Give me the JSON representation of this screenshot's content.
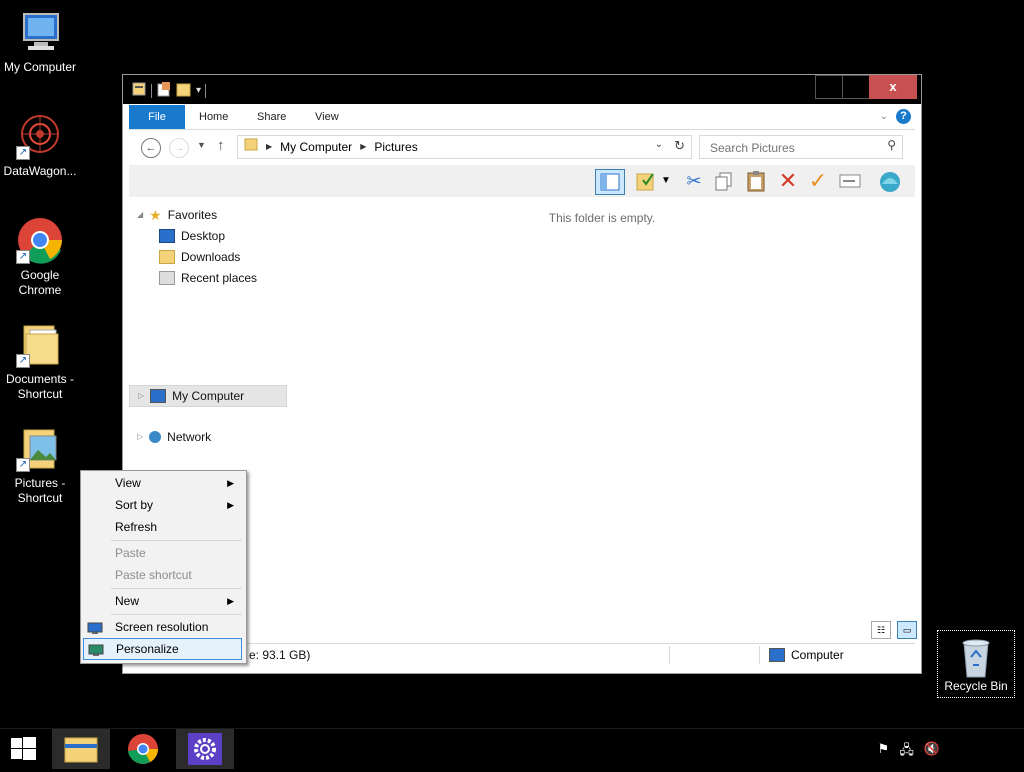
{
  "desktop": {
    "icons": [
      {
        "label": "My Computer"
      },
      {
        "label": "DataWagon..."
      },
      {
        "label": "Google Chrome"
      },
      {
        "label": "Documents - Shortcut"
      },
      {
        "label": "Pictures - Shortcut"
      }
    ],
    "recycle_bin": {
      "label": "Recycle Bin"
    }
  },
  "window": {
    "ribbon_tabs": [
      "File",
      "Home",
      "Share",
      "View"
    ],
    "help_label": "?",
    "address": {
      "crumbs": [
        "My Computer",
        "Pictures"
      ]
    },
    "search": {
      "placeholder": "Search Pictures"
    },
    "navigation": {
      "favorites_label": "Favorites",
      "favorites_items": [
        "Desktop",
        "Downloads",
        "Recent places"
      ],
      "computer_label": "My Computer",
      "network_label": "Network"
    },
    "content": {
      "empty_message": "This folder is empty."
    },
    "status": {
      "free_space": "e: 93.1 GB)",
      "location": "Computer"
    },
    "close_label": "x"
  },
  "context_menu": {
    "items": [
      {
        "label": "View",
        "submenu": true
      },
      {
        "label": "Sort by",
        "submenu": true
      },
      {
        "label": "Refresh"
      },
      {
        "label": "Paste",
        "disabled": true
      },
      {
        "label": "Paste shortcut",
        "disabled": true
      },
      {
        "label": "New",
        "submenu": true
      },
      {
        "label": "Screen resolution"
      },
      {
        "label": "Personalize"
      }
    ]
  },
  "colors": {
    "accent": "#1979ca",
    "close": "#c75050",
    "menu_highlight": "#e5f1fb"
  }
}
